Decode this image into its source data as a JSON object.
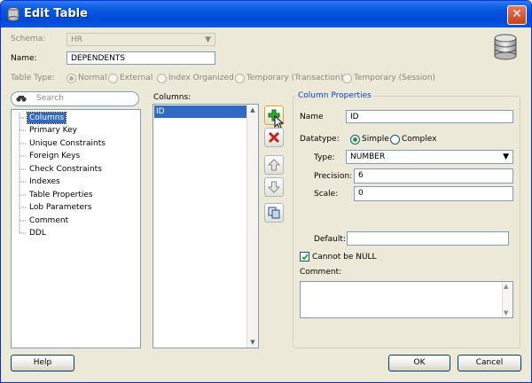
{
  "window": {
    "title": "Edit Table",
    "close": "✕"
  },
  "schema": {
    "label": "Schema:",
    "value": "HR"
  },
  "name": {
    "label": "Name:",
    "value": "DEPENDENTS"
  },
  "table_type": {
    "label": "Table Type:",
    "options": [
      "Normal",
      "External",
      "Index Organized",
      "Temporary (Transaction)",
      "Temporary (Session)"
    ],
    "selected": "Normal"
  },
  "search": {
    "placeholder": "Search"
  },
  "tree": {
    "items": [
      "Columns",
      "Primary Key",
      "Unique Constraints",
      "Foreign Keys",
      "Check Constraints",
      "Indexes",
      "Table Properties",
      "Lob Parameters",
      "Comment",
      "DDL"
    ],
    "selected": "Columns"
  },
  "columns": {
    "label": "Columns:",
    "items": [
      "ID"
    ]
  },
  "column_properties": {
    "title": "Column Properties",
    "name_label": "Name",
    "name_value": "ID",
    "datatype_label": "Datatype:",
    "datatype_options": [
      "Simple",
      "Complex"
    ],
    "datatype_selected": "Simple",
    "type_label": "Type:",
    "type_value": "NUMBER",
    "precision_label": "Precision:",
    "precision_value": "6",
    "scale_label": "Scale:",
    "scale_value": "0",
    "default_label": "Default:",
    "default_value": "",
    "not_null_label": "Cannot be NULL",
    "not_null_checked": true,
    "comment_label": "Comment:",
    "comment_value": ""
  },
  "buttons": {
    "help": "Help",
    "ok": "OK",
    "cancel": "Cancel"
  }
}
